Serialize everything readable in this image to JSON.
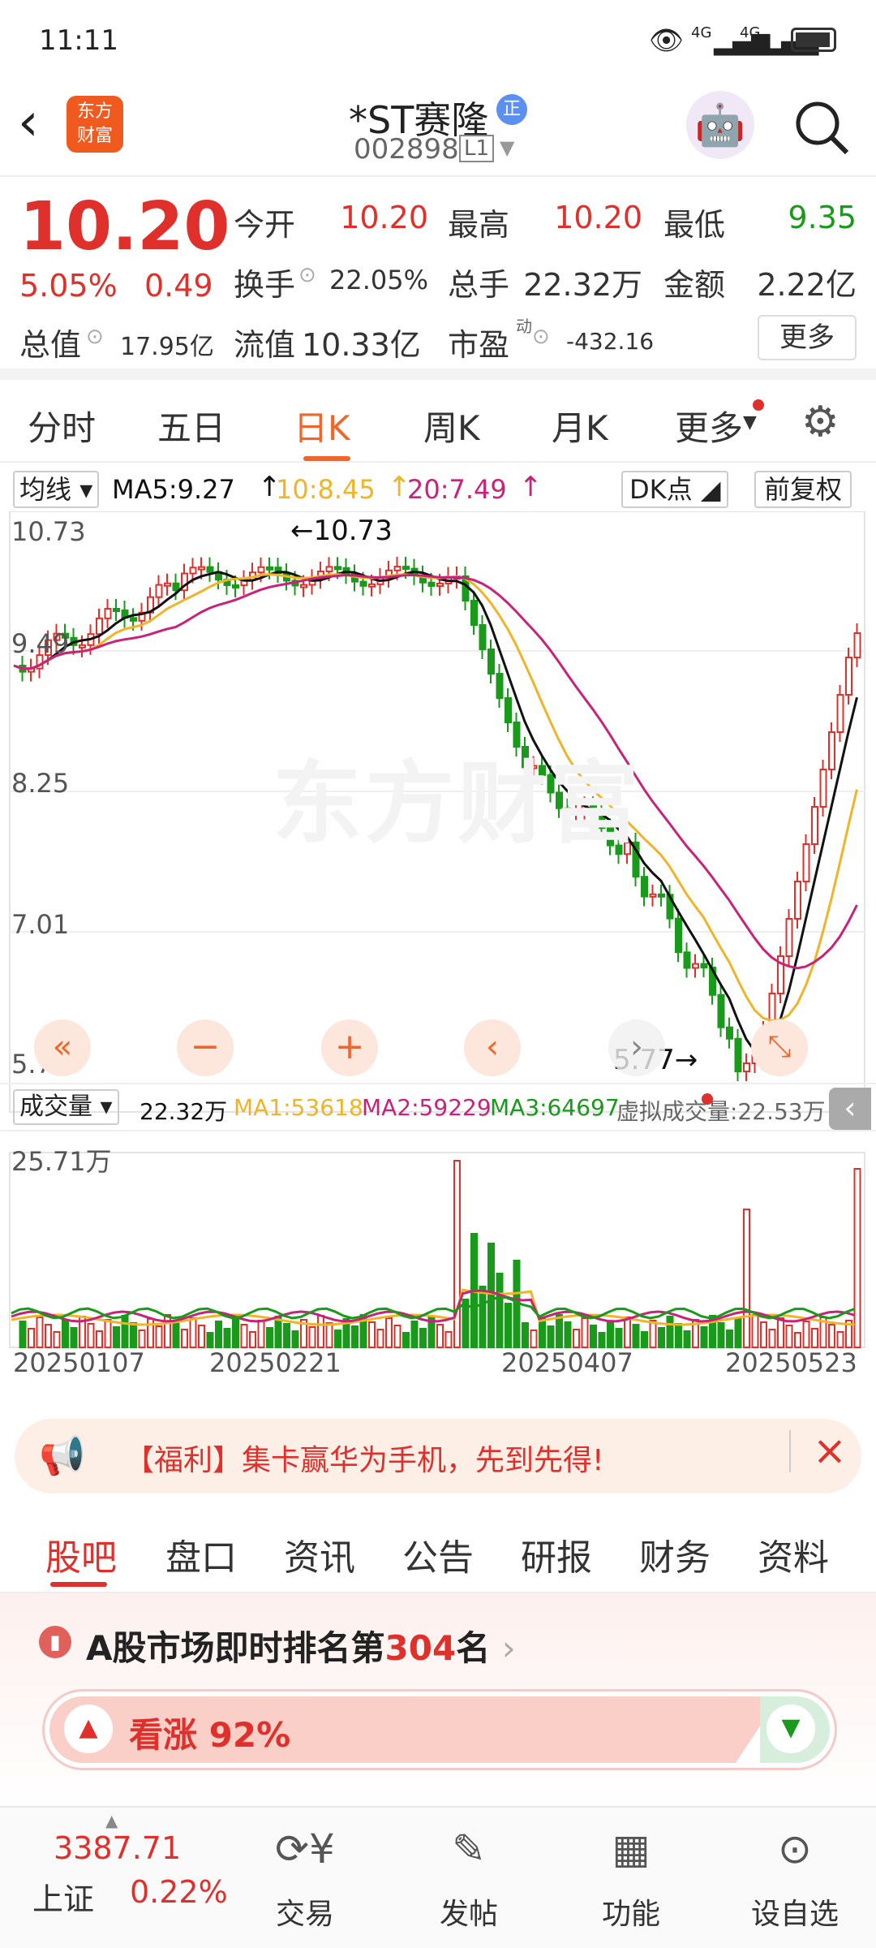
{
  "status": {
    "time": "11:11",
    "net1": "4G",
    "net2": "4G"
  },
  "header": {
    "title": "*ST赛隆",
    "badge": "正",
    "code": "002898",
    "level": "L1"
  },
  "quote": {
    "price": "10.20",
    "pct": "5.05%",
    "change": "0.49",
    "open_label": "今开",
    "open": "10.20",
    "high_label": "最高",
    "high": "10.20",
    "low_label": "最低",
    "low": "9.35",
    "turnover_label": "换手",
    "turnover": "22.05%",
    "vol_label": "总手",
    "vol": "22.32万",
    "amount_label": "金额",
    "amount": "2.22亿",
    "mcap_label": "总值",
    "mcap": "17.95亿",
    "fmcap_label": "流值",
    "fmcap": "10.33亿",
    "pe_label": "市盈",
    "pe_sup": "动",
    "pe": "-432.16",
    "more": "更多"
  },
  "tabs": [
    "分时",
    "五日",
    "日K",
    "周K",
    "月K",
    "更多"
  ],
  "chart": {
    "ma_label": "均线",
    "ma5": "MA5:9.27",
    "ma10": "10:8.45",
    "ma20": "20:7.49",
    "dk": "DK点",
    "fq": "前复权",
    "y_labels": [
      "10.73",
      "9.49",
      "8.25",
      "7.01",
      "5.77"
    ],
    "hi_ann": "←10.73",
    "lo_ann": "5.77→",
    "vol_sel": "成交量",
    "vol_now": "22.32万",
    "ma1": "MA1:53618",
    "ma2": "MA2:59229",
    "ma3": "MA3:64697",
    "vvol": "虚拟成交量:22.53万",
    "vol_max": "25.71万",
    "dates": [
      "20250107",
      "20250221",
      "20250407",
      "20250523"
    ],
    "watermark": "东方财富",
    "colors": {
      "up": "#e0302c",
      "down": "#1a9a1a",
      "ma5": "#111111",
      "ma10": "#f0b429",
      "ma20": "#c8237a"
    }
  },
  "banner": {
    "text": "【福利】集卡赢华为手机，先到先得!"
  },
  "subtabs": [
    "股吧",
    "盘口",
    "资讯",
    "公告",
    "研报",
    "财务",
    "资料"
  ],
  "rank": {
    "prefix": "A股市场即时排名第",
    "num": "304",
    "suffix": "名",
    "bull": "看涨 92%"
  },
  "bottom": {
    "index_val": "3387.71",
    "index_name": "上证",
    "index_pct": "0.22%",
    "items": [
      "交易",
      "发帖",
      "功能",
      "设自选"
    ]
  }
}
